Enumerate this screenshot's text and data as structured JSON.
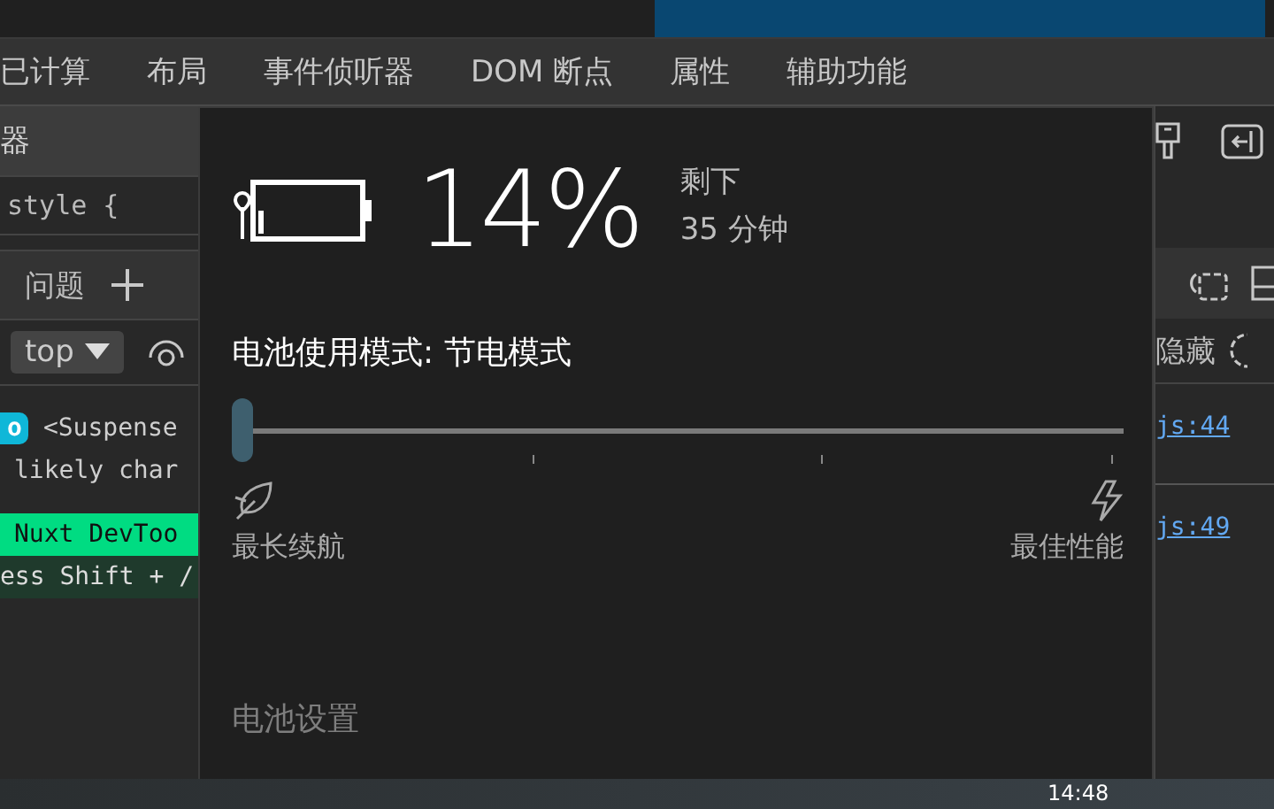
{
  "devtools": {
    "tabs": [
      {
        "label": "已计算",
        "selected": false
      },
      {
        "label": "布局",
        "selected": false
      },
      {
        "label": "事件侦听器",
        "selected": false
      },
      {
        "label": "DOM 断点",
        "selected": false
      },
      {
        "label": "属性",
        "selected": false
      },
      {
        "label": "辅助功能",
        "selected": false
      }
    ],
    "left_panel": {
      "header": "器",
      "rule": "style {",
      "drawer_tab": "问题",
      "context": "top",
      "console": [
        {
          "kind": "badge",
          "badge": "o",
          "text": "<Suspense"
        },
        {
          "kind": "plain",
          "text": "likely char"
        },
        {
          "kind": "nuxt",
          "text": "Nuxt DevToo"
        },
        {
          "kind": "hint",
          "text": "ess Shift + /"
        }
      ]
    },
    "right_panel": {
      "hidden_label": "隐藏",
      "links": [
        "js:44",
        "js:49"
      ]
    }
  },
  "battery_flyout": {
    "percent": "14%",
    "remaining_label": "剩下",
    "remaining_time": "35 分钟",
    "mode_label": "电池使用模式: 节电模式",
    "slider": {
      "level": 0,
      "min_label": "最长续航",
      "max_label": "最佳性能"
    },
    "settings_link": "电池设置"
  },
  "taskbar": {
    "clock": "14:48"
  }
}
